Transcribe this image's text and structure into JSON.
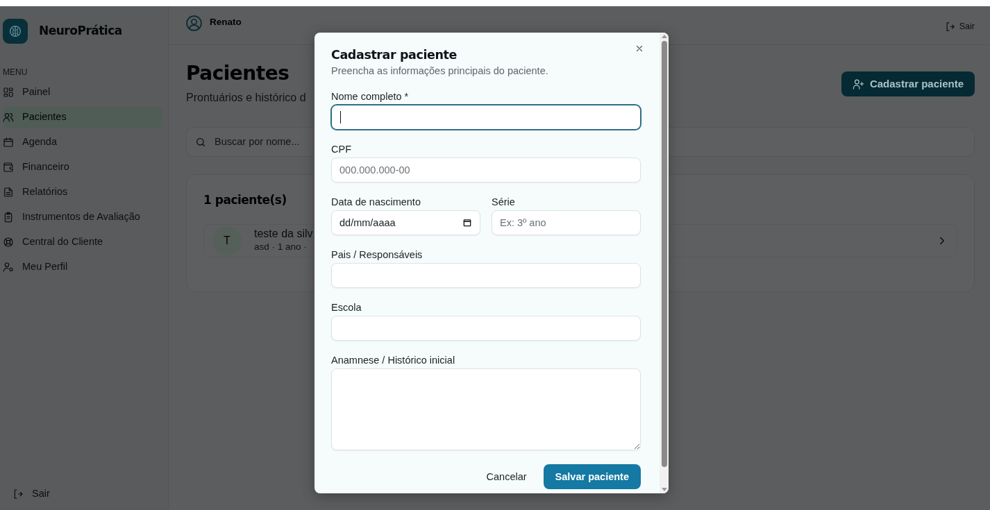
{
  "sidebar": {
    "brand": "NeuroPrática",
    "menu_heading": "MENU",
    "items": [
      {
        "label": "Painel",
        "selected": false
      },
      {
        "label": "Pacientes",
        "selected": true
      },
      {
        "label": "Agenda",
        "selected": false
      },
      {
        "label": "Financeiro",
        "selected": false
      },
      {
        "label": "Relatórios",
        "selected": false
      },
      {
        "label": "Instrumentos de Avaliação",
        "selected": false
      },
      {
        "label": "Central do Cliente",
        "selected": false
      },
      {
        "label": "Meu Perfil",
        "selected": false
      }
    ],
    "logout": "Sair"
  },
  "header": {
    "user": "Renato",
    "logout": "Sair"
  },
  "page": {
    "title": "Pacientes",
    "subtitle": "Prontuários e histórico d",
    "add_button": "Cadastrar paciente",
    "search": {
      "placeholder": "Buscar por nome..."
    },
    "count": "1 paciente(s)",
    "patients": [
      {
        "initial": "T",
        "name": "teste da silv",
        "details": "asd · 1 ano ·"
      }
    ]
  },
  "modal": {
    "title": "Cadastrar paciente",
    "subtitle": "Preencha as informações principais do paciente.",
    "rows": [
      [
        {
          "kind": "text",
          "label": "Nome completo *",
          "focused": true
        }
      ],
      [
        {
          "kind": "text",
          "label": "CPF",
          "placeholder": "000.000.000-00",
          "focused": false
        }
      ],
      [
        {
          "kind": "date",
          "label": "Data de nascimento",
          "value": "dd/mm/aaaa",
          "focused": false
        },
        {
          "kind": "text",
          "label": "Série",
          "placeholder": "Ex: 3º ano",
          "focused": false
        }
      ],
      [
        {
          "kind": "text",
          "label": "Pais / Responsáveis",
          "focused": false
        }
      ],
      [
        {
          "kind": "text",
          "label": "Escola",
          "focused": false
        }
      ],
      [
        {
          "kind": "textarea",
          "label": "Anamnese / Histórico inicial",
          "focused": false
        }
      ]
    ],
    "cancel": "Cancelar",
    "save": "Salvar paciente"
  }
}
